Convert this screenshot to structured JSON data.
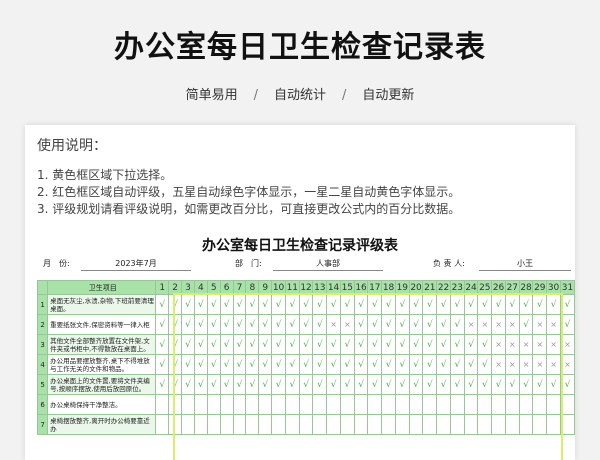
{
  "header": {
    "title": "办公室每日卫生检查记录表",
    "features": [
      "简单易用",
      "自动统计",
      "自动更新"
    ],
    "separator": "/"
  },
  "usage": {
    "heading": "使用说明：",
    "items": [
      "1. 黄色框区域下拉选择。",
      "2. 红色框区域自动评级，五星自动绿色字体显示，一星二星自动黄色字体显示。",
      "3. 评级规划请看评级说明，如需更改百分比，可直接更改公式内的百分比数据。"
    ]
  },
  "table": {
    "title": "办公室每日卫生检查记录评级表",
    "meta": {
      "month_label": "月　份:",
      "month_value": "2023年7月",
      "dept_label": "部　门:",
      "dept_value": "人事部",
      "owner_label": "负 责 人:",
      "owner_value": "小王"
    },
    "item_header": "卫生项目",
    "days": [
      "1",
      "2",
      "3",
      "4",
      "5",
      "6",
      "7",
      "8",
      "9",
      "10",
      "11",
      "12",
      "13",
      "14",
      "15",
      "16",
      "17",
      "18",
      "19",
      "20",
      "21",
      "22",
      "23",
      "24",
      "25",
      "26",
      "27",
      "28",
      "29",
      "30",
      "31"
    ],
    "rows": [
      {
        "no": "1",
        "item": "桌面无灰尘,水渍,杂物,下班前要清理桌面。",
        "marks": "√√√√√√√√√√√√√√√√√√√√√√√√√√√√√√√"
      },
      {
        "no": "2",
        "item": "重要纸张文件,保密资料等一律入柜",
        "marks": "√√√√√√√√√√√√√××√√√√√√√√××××√××√"
      },
      {
        "no": "3",
        "item": "其他文件全部整齐放置在文件架,文件夹或书柜中,不得散放在桌面上。",
        "marks": "√√√√√√√√√√√√√√√√√√√√√√√√√××××××"
      },
      {
        "no": "4",
        "item": "办公用品要摆放整齐,桌下不得堆放与工作无关的文件和物品。",
        "marks": "√√√√√√√√√√√√√√√√√√√√√√√√√××××××"
      },
      {
        "no": "5",
        "item": "办公桌面上的文件置,要将文件夹编号,按顺序摆放,使用后放回原位。",
        "marks": "√√√√√√√√√√√√√√√√√√√√√√√√√√√√√√√"
      },
      {
        "no": "6",
        "item": "办公桌椅保持干净整洁。",
        "marks": ""
      },
      {
        "no": "7",
        "item": "桌椅摆放整齐,离开时办公椅要靠近办",
        "marks": ""
      }
    ],
    "ok_mark": "√",
    "no_mark": "×",
    "colors": {
      "header_green": "#a9e2a9",
      "check_green": "#4ab04a",
      "frame_yellow": "#d9ee6b"
    }
  }
}
